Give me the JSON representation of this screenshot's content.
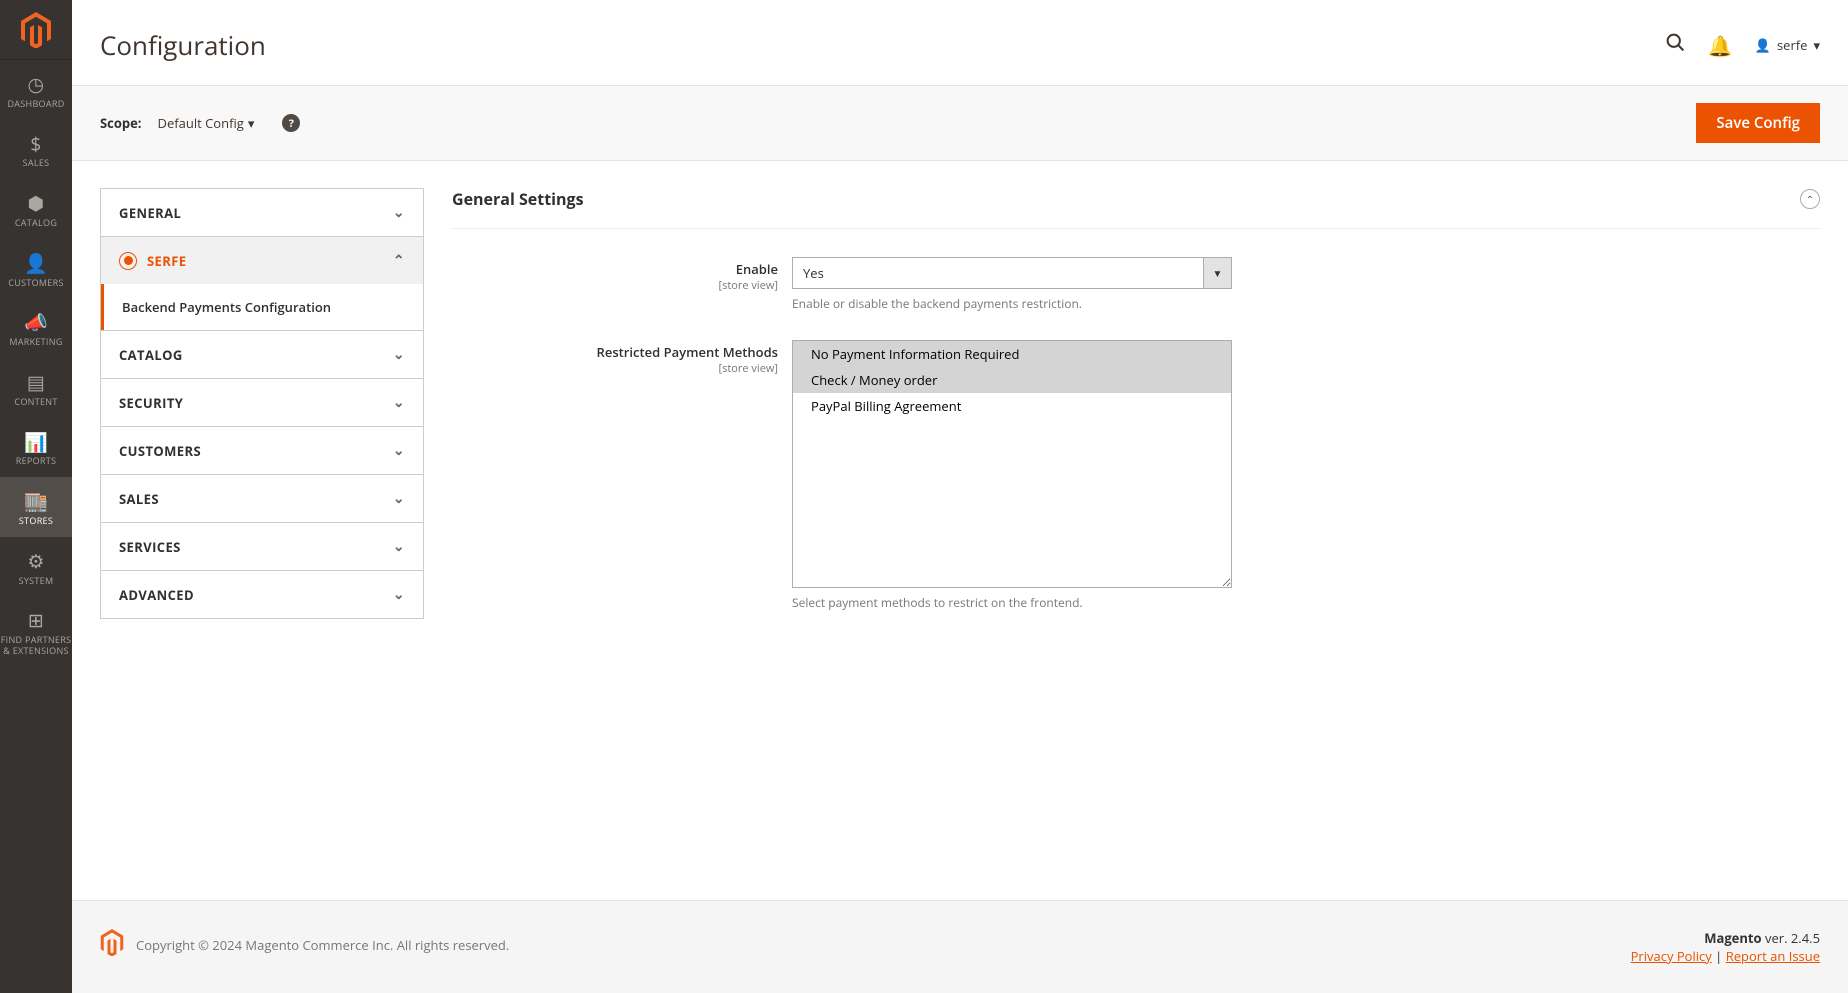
{
  "header": {
    "title": "Configuration",
    "user": "serfe"
  },
  "toolbar": {
    "scope_label": "Scope:",
    "scope_value": "Default Config",
    "save_label": "Save Config"
  },
  "nav": {
    "dashboard": "DASHBOARD",
    "sales": "SALES",
    "catalog": "CATALOG",
    "customers": "CUSTOMERS",
    "marketing": "MARKETING",
    "content": "CONTENT",
    "reports": "REPORTS",
    "stores": "STORES",
    "system": "SYSTEM",
    "find_partners": "FIND PARTNERS\n& EXTENSIONS"
  },
  "tabs": {
    "general": "GENERAL",
    "serfe": "SERFE",
    "serfe_sub": "Backend Payments Configuration",
    "catalog": "CATALOG",
    "security": "SECURITY",
    "customers": "CUSTOMERS",
    "sales": "SALES",
    "services": "SERVICES",
    "advanced": "ADVANCED"
  },
  "section": {
    "title": "General Settings",
    "store_view": "[store view]",
    "field_enable": {
      "label": "Enable",
      "value": "Yes",
      "hint": "Enable or disable the backend payments restriction."
    },
    "field_restricted": {
      "label": "Restricted Payment Methods",
      "options": {
        "opt1": "No Payment Information Required",
        "opt2": "Check / Money order",
        "opt3": "PayPal Billing Agreement"
      },
      "hint": "Select payment methods to restrict on the frontend."
    }
  },
  "footer": {
    "copyright": "Copyright © 2024 Magento Commerce Inc. All rights reserved.",
    "magento": "Magento",
    "version": " ver. 2.4.5",
    "privacy": "Privacy Policy",
    "sep": " | ",
    "report": "Report an Issue"
  }
}
